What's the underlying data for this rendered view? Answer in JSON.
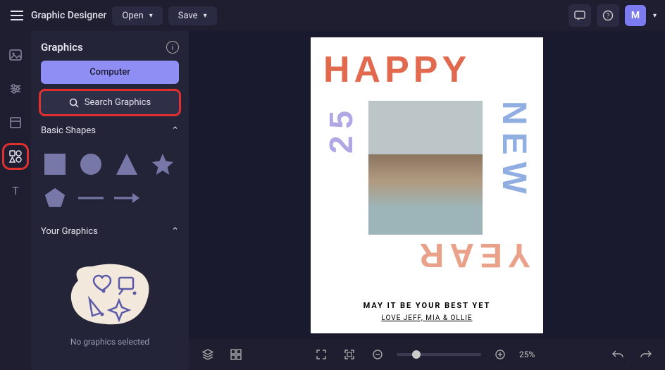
{
  "header": {
    "app_title": "Graphic Designer",
    "open_label": "Open",
    "save_label": "Save",
    "avatar_initial": "M"
  },
  "panel": {
    "title": "Graphics",
    "computer_btn": "Computer",
    "search_btn": "Search Graphics",
    "basic_shapes_label": "Basic Shapes",
    "your_graphics_label": "Your Graphics",
    "empty_label": "No graphics selected"
  },
  "design": {
    "happy": "HAPPY",
    "new": "NEW",
    "year": "YEAR",
    "twentyfive": "25",
    "tagline": "MAY IT BE YOUR BEST YET",
    "signature": "LOVE JEFF, MIA & OLLIE"
  },
  "bottombar": {
    "zoom_label": "25%"
  },
  "colors": {
    "accent": "#8e8ef5",
    "highlight": "#e03030"
  }
}
